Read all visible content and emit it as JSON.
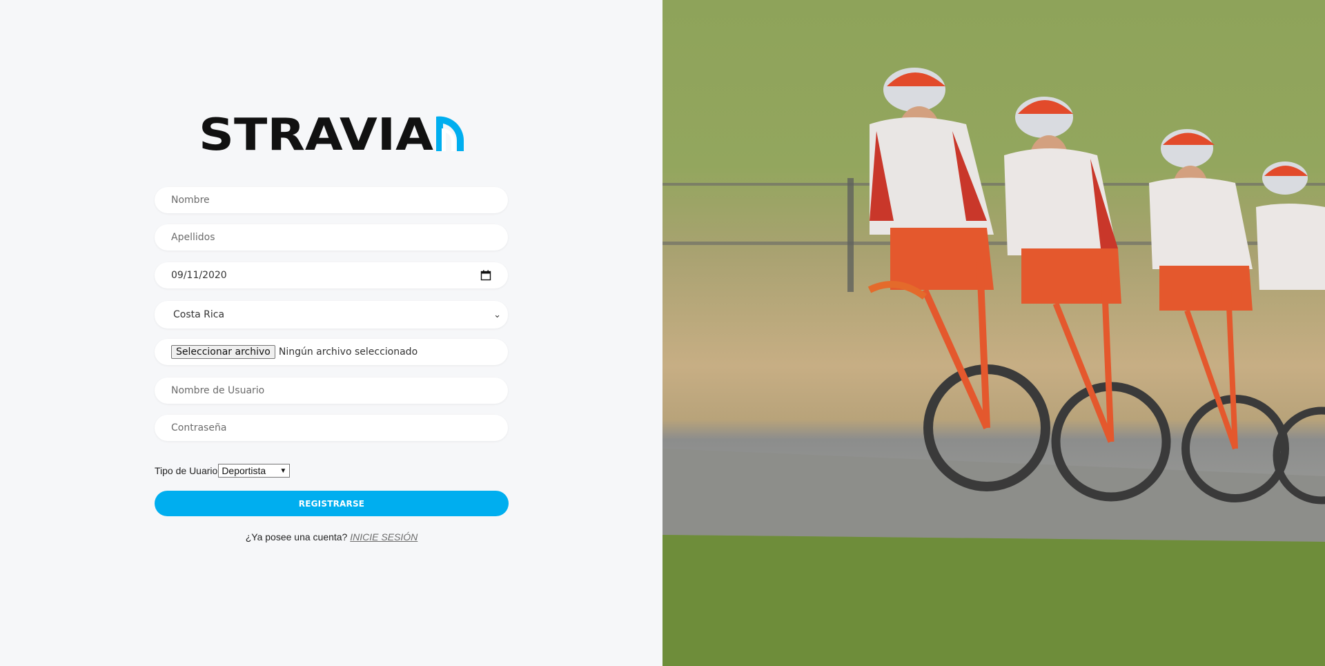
{
  "brand": {
    "name": "STRAVIA"
  },
  "form": {
    "nombre_placeholder": "Nombre",
    "apellidos_placeholder": "Apellidos",
    "fecha_value": "09/11/2020",
    "pais_value": "Costa Rica",
    "file_button_label": "Seleccionar archivo",
    "file_status": "Ningún archivo seleccionado",
    "usuario_placeholder": "Nombre de Usuario",
    "password_placeholder": "Contraseña",
    "tipo_label": "Tipo de Uuario",
    "tipo_value": "Deportista",
    "register_label": "REGISTRARSE"
  },
  "footer": {
    "question": "¿Ya posee una cuenta?",
    "login_link": "INICIE SESIÓN"
  },
  "colors": {
    "accent": "#00aeef",
    "background": "#f6f7f9"
  },
  "image": {
    "description_icon": "cyclists-photo"
  }
}
